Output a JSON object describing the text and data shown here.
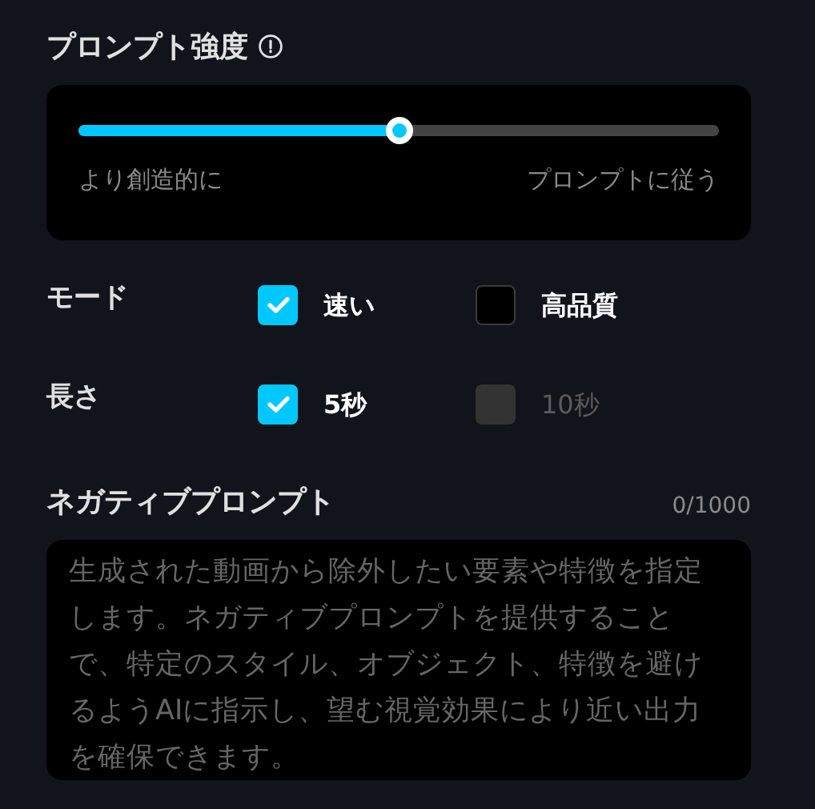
{
  "strength": {
    "title": "プロンプト強度",
    "slider": {
      "level": 0.5
    },
    "left_label": "より創造的に",
    "right_label": "プロンプトに従う"
  },
  "options": [
    {
      "label": "モード",
      "choices": [
        {
          "label": "速い",
          "checked": true,
          "disabled": false
        },
        {
          "label": "高品質",
          "checked": false,
          "disabled": false
        }
      ]
    },
    {
      "label": "長さ",
      "choices": [
        {
          "label": "5秒",
          "checked": true,
          "disabled": false
        },
        {
          "label": "10秒",
          "checked": false,
          "disabled": true
        }
      ]
    }
  ],
  "negative_prompt": {
    "title": "ネガティブプロンプト",
    "counter": "0/1000",
    "placeholder": "生成された動画から除外したい要素や特徴を指定します。ネガティブプロンプトを提供することで、特定のスタイル、オブジェクト、特徴を避けるようAIに指示し、望む視覚効果により近い出力を確保できます。"
  }
}
